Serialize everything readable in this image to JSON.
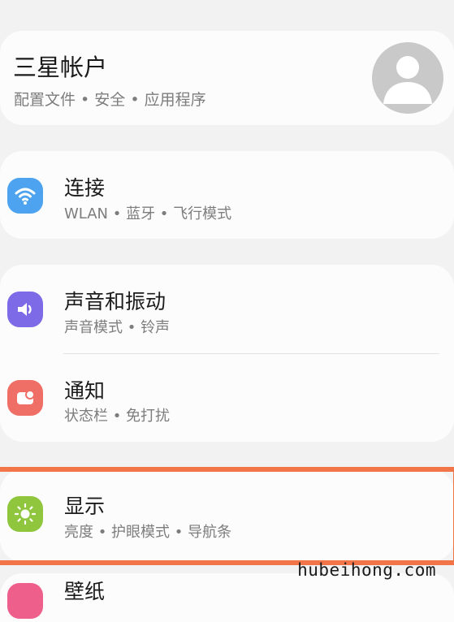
{
  "account": {
    "title": "三星帐户",
    "subtitle": "配置文件 • 安全 • 应用程序"
  },
  "settings": [
    {
      "title": "连接",
      "subtitle": "WLAN • 蓝牙 • 飞行模式",
      "icon": "wifi-icon",
      "icon_color": "#4da3ef"
    },
    {
      "title": "声音和振动",
      "subtitle": "声音模式 • 铃声",
      "icon": "speaker-icon",
      "icon_color": "#7c6ae6"
    },
    {
      "title": "通知",
      "subtitle": "状态栏 • 免打扰",
      "icon": "notification-icon",
      "icon_color": "#ef6f66"
    },
    {
      "title": "显示",
      "subtitle": "亮度 • 护眼模式 • 导航条",
      "icon": "brightness-icon",
      "icon_color": "#8fc63e"
    },
    {
      "title": "壁纸",
      "icon": "wallpaper-icon",
      "icon_color": "#ee5f8c"
    }
  ],
  "highlight_color": "#f2754a",
  "watermark": "hubeihong.com"
}
